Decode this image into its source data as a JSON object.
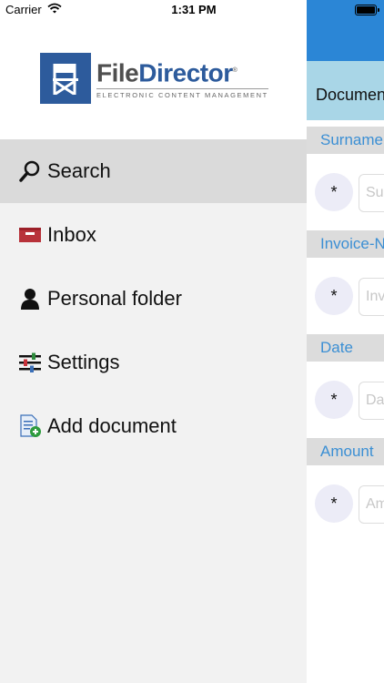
{
  "status_bar": {
    "carrier": "Carrier",
    "time": "1:31 PM"
  },
  "logo": {
    "name_part1": "File",
    "name_part2": "Director",
    "registered": "®",
    "tagline": "ELECTRONIC CONTENT MANAGEMENT"
  },
  "menu": {
    "items": [
      {
        "label": "Search",
        "icon": "magnifier-icon",
        "selected": true
      },
      {
        "label": "Inbox",
        "icon": "inbox-icon"
      },
      {
        "label": "Personal folder",
        "icon": "person-icon"
      },
      {
        "label": "Settings",
        "icon": "sliders-icon"
      },
      {
        "label": "Add document",
        "icon": "add-document-icon"
      }
    ]
  },
  "content": {
    "document_bar_title": "Document",
    "fields": [
      {
        "label": "Surname",
        "required": "*",
        "placeholder": "Surname"
      },
      {
        "label": "Invoice-No",
        "required": "*",
        "placeholder": "Invoice-No"
      },
      {
        "label": "Date",
        "required": "*",
        "placeholder": "Date"
      },
      {
        "label": "Amount",
        "required": "*",
        "placeholder": "Amount"
      }
    ]
  },
  "colors": {
    "nav_blue": "#2b86d6",
    "doc_bar": "#a9d6e7",
    "field_label": "#3b8fd4",
    "selected_row": "#dadada"
  }
}
